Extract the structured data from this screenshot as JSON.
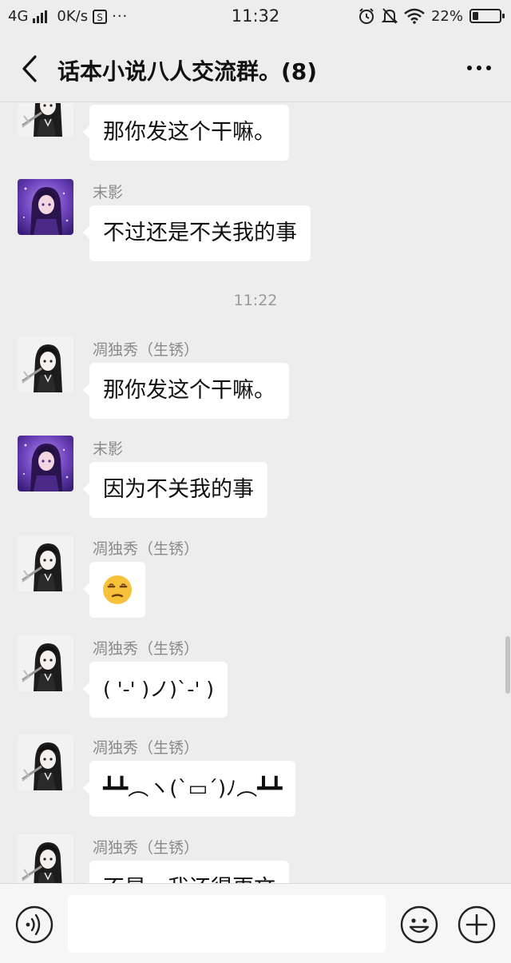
{
  "status_bar": {
    "network": "4G",
    "speed": "0K/s",
    "time": "11:32",
    "battery_pct": "22%",
    "battery_level": 0.22
  },
  "header": {
    "title": "话本小说八人交流群。(8)"
  },
  "messages": [
    {
      "sender": "",
      "text": "那你发这个干嘛。",
      "avatar": "dark-hair-girl-avatar"
    },
    {
      "sender": "末影",
      "text": "不过还是不关我的事",
      "avatar": "purple-girl-avatar"
    },
    {
      "sender": "凋独秀（生锈）",
      "text": "那你发这个干嘛。",
      "avatar": "dark-hair-girl-avatar"
    },
    {
      "sender": "末影",
      "text": "因为不关我的事",
      "avatar": "purple-girl-avatar"
    },
    {
      "sender": "凋独秀（生锈）",
      "text": "",
      "emoji": "unamused-face",
      "avatar": "dark-hair-girl-avatar"
    },
    {
      "sender": "凋独秀（生锈）",
      "text": "( '-' )ノ)`-' )",
      "avatar": "dark-hair-girl-avatar"
    },
    {
      "sender": "凋独秀（生锈）",
      "text": "┻┻︵ヽ(`▭´)ﾉ︵┻┻",
      "avatar": "dark-hair-girl-avatar"
    },
    {
      "sender": "凋独秀（生锈）",
      "text": "不是，我还得更文",
      "avatar": "dark-hair-girl-avatar"
    }
  ],
  "timestamp": "11:22",
  "input": {
    "value": "",
    "placeholder": ""
  },
  "colors": {
    "background": "#ededed",
    "bubble": "#ffffff",
    "sender": "#8a8a8a"
  }
}
